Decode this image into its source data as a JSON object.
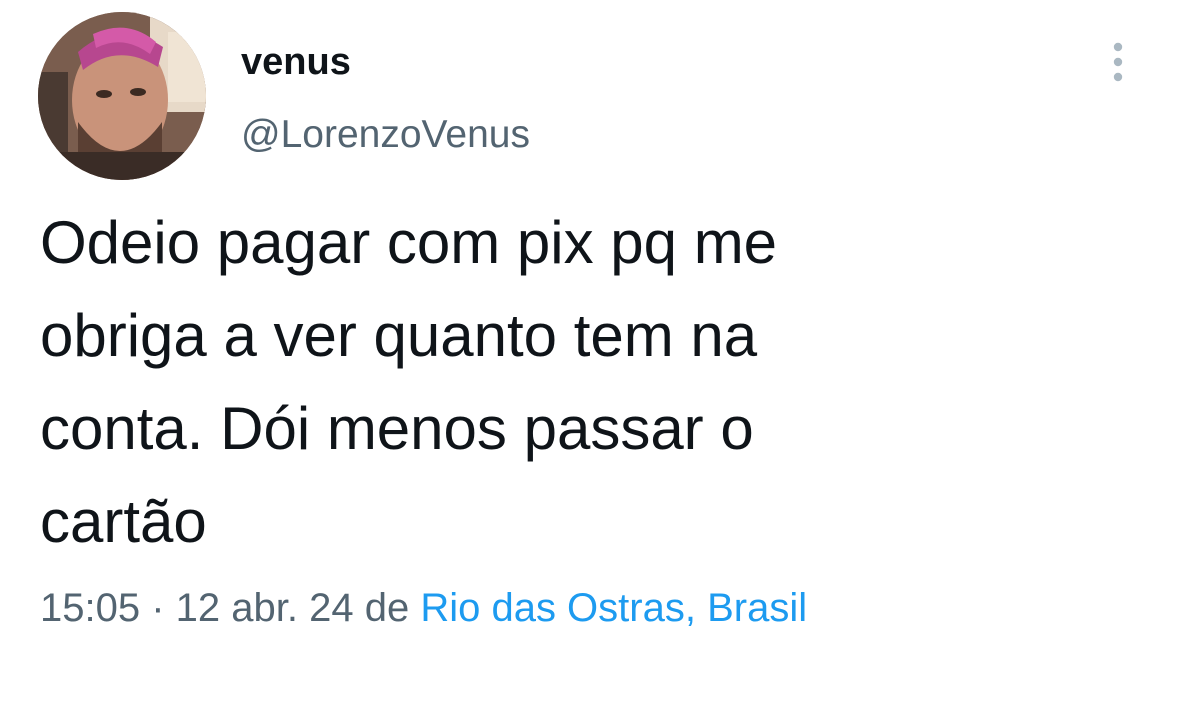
{
  "author": {
    "display_name": "venus",
    "handle": "@LorenzoVenus",
    "avatar_icon": "user-avatar-photo"
  },
  "tweet": {
    "text": "Odeio pagar com pix pq me\nobriga a ver quanto tem na\nconta. Dói menos passar o\ncartão",
    "time": "15:05",
    "separator": " · ",
    "date": "12 abr. 24",
    "from_label": " de ",
    "location": "Rio das Ostras, Brasil"
  },
  "more_button": {
    "icon": "more-vertical-icon"
  },
  "colors": {
    "text_primary": "#0f1419",
    "text_secondary": "#536471",
    "link": "#1d9bf0",
    "more_icon": "#aab8c2"
  }
}
